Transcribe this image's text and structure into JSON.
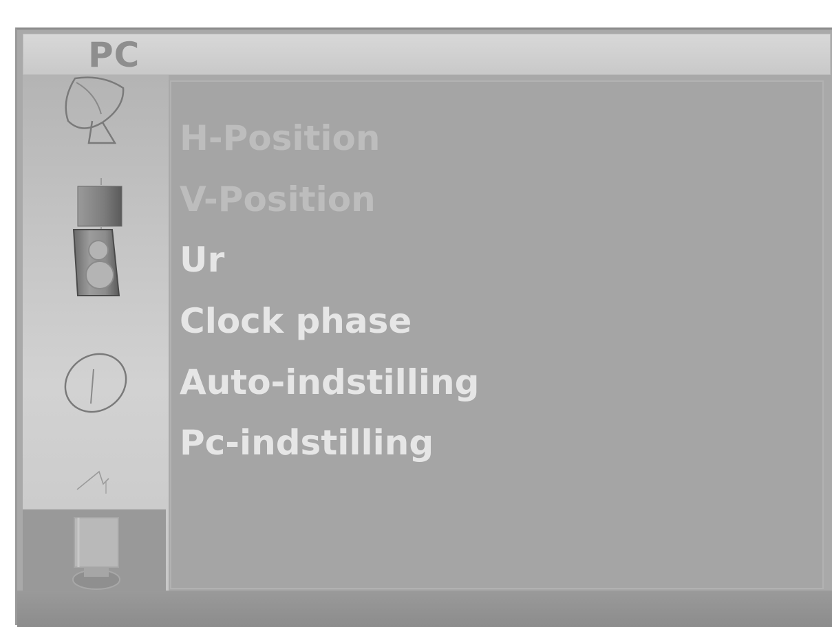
{
  "header": {
    "title": "PC"
  },
  "sidebar": {
    "items": [
      {
        "icon": "satellite-dish-icon"
      },
      {
        "icon": "picture-cube-icon"
      },
      {
        "icon": "audio-speaker-icon"
      },
      {
        "icon": "clock-icon"
      },
      {
        "icon": "option-icon"
      },
      {
        "icon": "pc-monitor-icon",
        "selected": true
      }
    ]
  },
  "menu": {
    "items": [
      {
        "label": "H-Position"
      },
      {
        "label": "V-Position"
      },
      {
        "label": "Ur"
      },
      {
        "label": "Clock phase"
      },
      {
        "label": "Auto-indstilling"
      },
      {
        "label": "Pc-indstilling"
      }
    ]
  },
  "colors": {
    "background": "#a9a9a9",
    "title_bar": "#d0d0d0",
    "selected_icon_bg": "#999999",
    "dim_text": "#bdbdbd",
    "bright_text": "#e6e6e6"
  }
}
